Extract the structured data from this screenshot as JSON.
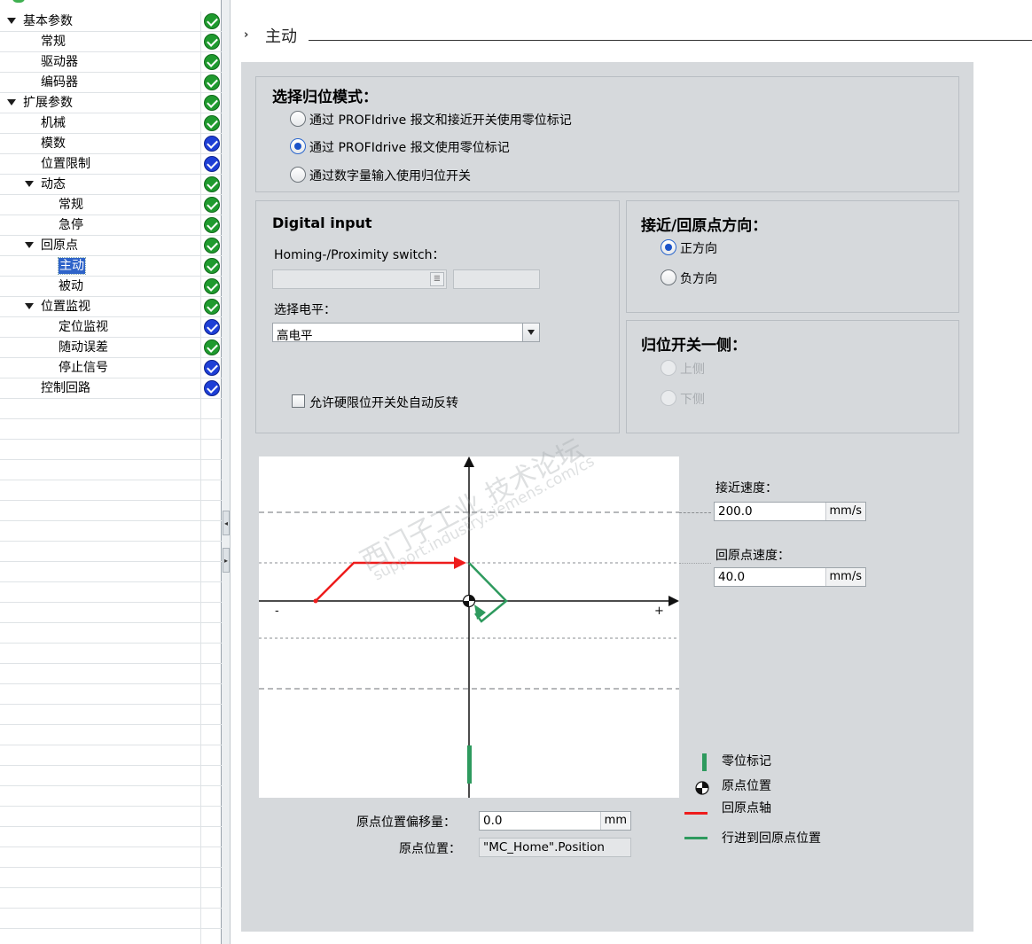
{
  "tree": {
    "items": [
      {
        "label": "基本参数",
        "level": 0,
        "expanded": true,
        "status": "ok"
      },
      {
        "label": "常规",
        "level": 1,
        "status": "ok"
      },
      {
        "label": "驱动器",
        "level": 1,
        "status": "ok"
      },
      {
        "label": "编码器",
        "level": 1,
        "status": "ok"
      },
      {
        "label": "扩展参数",
        "level": 0,
        "expanded": true,
        "status": "ok"
      },
      {
        "label": "机械",
        "level": 1,
        "status": "ok"
      },
      {
        "label": "模数",
        "level": 1,
        "status": "blue"
      },
      {
        "label": "位置限制",
        "level": 1,
        "status": "blue"
      },
      {
        "label": "动态",
        "level": 1,
        "expanded": true,
        "status": "ok"
      },
      {
        "label": "常规",
        "level": 2,
        "status": "ok"
      },
      {
        "label": "急停",
        "level": 2,
        "status": "ok"
      },
      {
        "label": "回原点",
        "level": 1,
        "expanded": true,
        "status": "ok"
      },
      {
        "label": "主动",
        "level": 2,
        "status": "ok",
        "selected": true
      },
      {
        "label": "被动",
        "level": 2,
        "status": "ok"
      },
      {
        "label": "位置监视",
        "level": 1,
        "expanded": true,
        "status": "ok"
      },
      {
        "label": "定位监视",
        "level": 2,
        "status": "blue"
      },
      {
        "label": "随动误差",
        "level": 2,
        "status": "ok"
      },
      {
        "label": "停止信号",
        "level": 2,
        "status": "blue"
      },
      {
        "label": "控制回路",
        "level": 1,
        "status": "blue"
      }
    ]
  },
  "header": {
    "arrow": "›",
    "title": "主动"
  },
  "mode_group": {
    "title": "选择归位模式：",
    "options": [
      {
        "label": "通过 PROFIdrive 报文和接近开关使用零位标记",
        "checked": false
      },
      {
        "label": "通过 PROFIdrive 报文使用零位标记",
        "checked": true
      },
      {
        "label": "通过数字量输入使用归位开关",
        "checked": false
      }
    ]
  },
  "digital_input": {
    "title": "Digital input",
    "switch_label": "Homing-/Proximity switch：",
    "switch_value": "",
    "switch_extra": "",
    "level_label": "选择电平：",
    "level_value": "高电平",
    "auto_reverse_label": "允许硬限位开关处自动反转",
    "auto_reverse_checked": false
  },
  "direction_group": {
    "title": "接近/回原点方向：",
    "options": [
      {
        "label": "正方向",
        "checked": true
      },
      {
        "label": "负方向",
        "checked": false
      }
    ]
  },
  "side_group": {
    "title": "归位开关一侧：",
    "options": [
      {
        "label": "上侧",
        "checked": false,
        "disabled": true
      },
      {
        "label": "下侧",
        "checked": false,
        "disabled": true
      }
    ]
  },
  "speeds": {
    "approach_label": "接近速度：",
    "approach_value": "200.0",
    "approach_unit": "mm/s",
    "homing_label": "回原点速度：",
    "homing_value": "40.0",
    "homing_unit": "mm/s"
  },
  "diagram": {
    "minus": "-",
    "plus": "+"
  },
  "legend": [
    {
      "label": "零位标记",
      "symbol": "green-bar",
      "color": "#2e9a5e"
    },
    {
      "label": "原点位置",
      "symbol": "home-target"
    },
    {
      "label": "回原点轴",
      "symbol": "red-line",
      "color": "#ee1c1c"
    },
    {
      "label": "行进到回原点位置",
      "symbol": "green-line",
      "color": "#2e9a5e"
    }
  ],
  "offset": {
    "label": "原点位置偏移量：",
    "value": "0.0",
    "unit": "mm"
  },
  "home_position": {
    "label": "原点位置：",
    "value": "\"MC_Home\".Position"
  },
  "watermark": {
    "line1": "西门子工业 技术论坛",
    "line2": "support.industry.siemens.com/cs"
  }
}
